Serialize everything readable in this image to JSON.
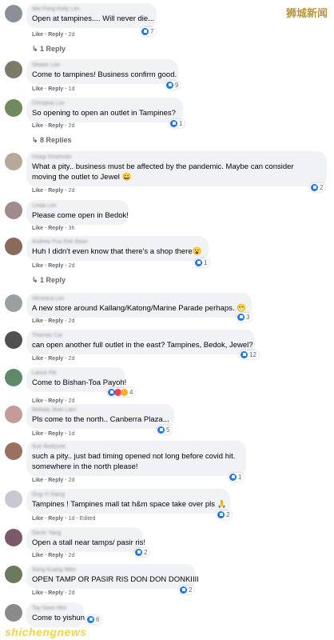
{
  "watermark": "狮城新闻",
  "watermark_bottom": "shichengnews",
  "action_labels": {
    "like": "Like",
    "sep": " · ",
    "reply": "Reply"
  },
  "comments": [
    {
      "name": "Mei Fong Kelly Lim",
      "text": [
        "Open at tampines.... Will never die..."
      ],
      "time": "2d",
      "reactions": "7",
      "reply_link": "1 Reply",
      "avatar_color": "#8a8f98"
    },
    {
      "name": "Shawn Lee",
      "text": [
        "Come to tampines! Business confirm good."
      ],
      "time": "1d",
      "reactions": "9",
      "reply_link": "",
      "avatar_color": "#7d7a68"
    },
    {
      "name": "Christina Lim",
      "text": [
        "So opening to open an outlet in Tampines?"
      ],
      "time": "2d",
      "reactions": "1",
      "reply_link": "8 Replies",
      "avatar_color": "#6e8a5e"
    },
    {
      "name": "Usagi Kinomoto",
      "text": [
        "What a pity.. business must be affected by the pandemic. Maybe can consider",
        "moving the outlet to Jewel 😀"
      ],
      "time": "2d",
      "reactions": "2",
      "reply_link": "",
      "avatar_color": "#b5a99a"
    },
    {
      "name": "Linda Lim",
      "text": [
        "Please come open in Bedok!"
      ],
      "time": "3h",
      "reactions": "",
      "reply_link": "",
      "avatar_color": "#a08a8a"
    },
    {
      "name": "Andrew Foo Eek Boon",
      "text": [
        "Huh I didn't even know that there's a shop there😮"
      ],
      "time": "2d",
      "reactions": "1",
      "reply_link": "1 Reply",
      "avatar_color": "#8a6a5a"
    },
    {
      "name": "Veronica Lim",
      "text": [
        "A new store around Kallang/Katong/Marine Parade perhaps. 😁"
      ],
      "time": "2d",
      "reactions": "3",
      "reply_link": "",
      "avatar_color": "#9aa0a0"
    },
    {
      "name": "Thomas Cai",
      "text": [
        "can open another full outlet in the east? Tampines, Bedok, Jewel?"
      ],
      "time": "2d",
      "reactions": "12",
      "reply_link": "",
      "avatar_color": "#505050"
    },
    {
      "name": "Lance Pik",
      "text": [
        "Come to Bishan-Toa Payoh!"
      ],
      "time": "2d",
      "reactions": "4",
      "reply_link": "",
      "avatar_color": "#5f8a6a"
    },
    {
      "name": "Melody Jean Lam",
      "text": [
        "Pls come to the north.. Canberra Plaza..."
      ],
      "time": "1d",
      "reactions": "5",
      "reply_link": "",
      "avatar_color": "#c49a9a"
    },
    {
      "name": "Sue Rodzyne",
      "text": [
        "such a pity.. just bad timing opened not long before covid hit.",
        "somewhere in the north please!"
      ],
      "time": "2d",
      "reactions": "1",
      "reply_link": "",
      "avatar_color": "#9a7060"
    },
    {
      "name": "Ong Yi Xiang",
      "text": [
        "Tampines ! Tampines mall tat h&m space take over pls 🙏"
      ],
      "time": "1d",
      "reactions": "2",
      "edited": "Edited",
      "reply_link": "",
      "avatar_color": "#c8c8d0"
    },
    {
      "name": "Daver Yang",
      "text": [
        "Open a stall near tamps/ pasir ris!"
      ],
      "time": "2d",
      "reactions": "2",
      "reply_link": "",
      "avatar_color": "#7a5a6a"
    },
    {
      "name": "Song Kuang Wee",
      "text": [
        "OPEN TAMP OR PASIR RIS DON DON DONKIIII"
      ],
      "time": "2d",
      "reactions": "2",
      "reply_link": "",
      "avatar_color": "#6a7a5a"
    },
    {
      "name": "Tay Soon Wei",
      "text": [
        "Come to yishun"
      ],
      "time": "",
      "reactions": "6",
      "reply_link": "",
      "avatar_color": "#8a8a8a"
    }
  ]
}
